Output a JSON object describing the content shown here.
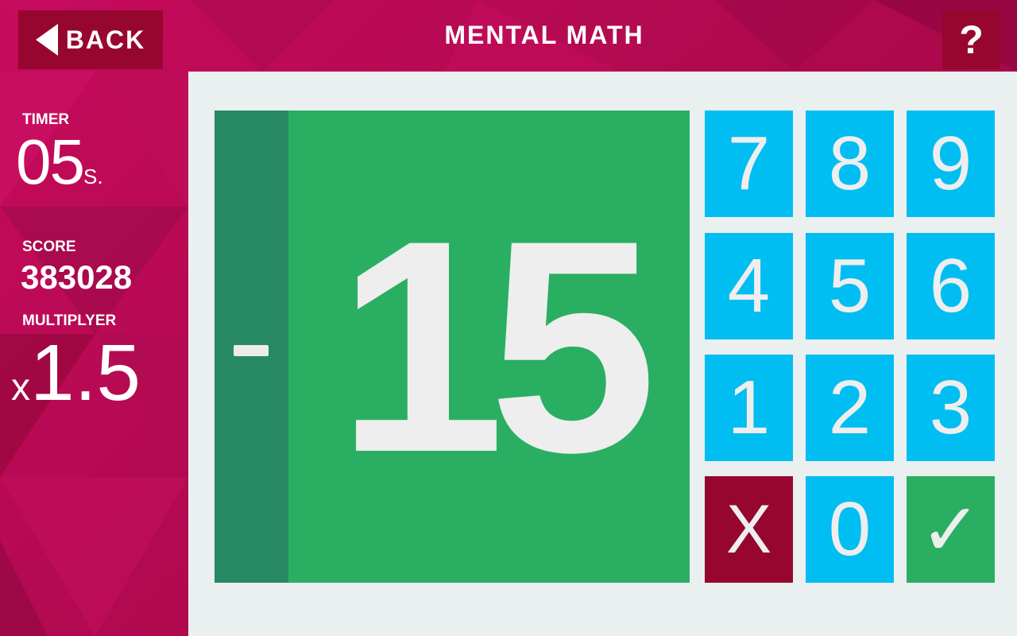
{
  "header": {
    "back_label": "BACK",
    "title": "MENTAL MATH",
    "help_label": "?"
  },
  "stats": {
    "timer_label": "TIMER",
    "timer_value": "05",
    "timer_unit": "S.",
    "score_label": "SCORE",
    "score_value": "383028",
    "multiplier_label": "MULTIPLYER",
    "multiplier_prefix": "x",
    "multiplier_value": "1.5"
  },
  "answer": {
    "sign": "-",
    "value": "15"
  },
  "keypad": {
    "keys": [
      "7",
      "8",
      "9",
      "4",
      "5",
      "6",
      "1",
      "2",
      "3"
    ],
    "clear_label": "X",
    "zero_label": "0",
    "submit_label": "✓"
  },
  "colors": {
    "background": "#b50a52",
    "header_button": "#96062f",
    "panel": "#eaeff0",
    "answer_box": "#2aaf62",
    "sign_strip": "#278963",
    "key": "#00bef1",
    "clear_key": "#96062f",
    "submit_key": "#2aaf62"
  }
}
